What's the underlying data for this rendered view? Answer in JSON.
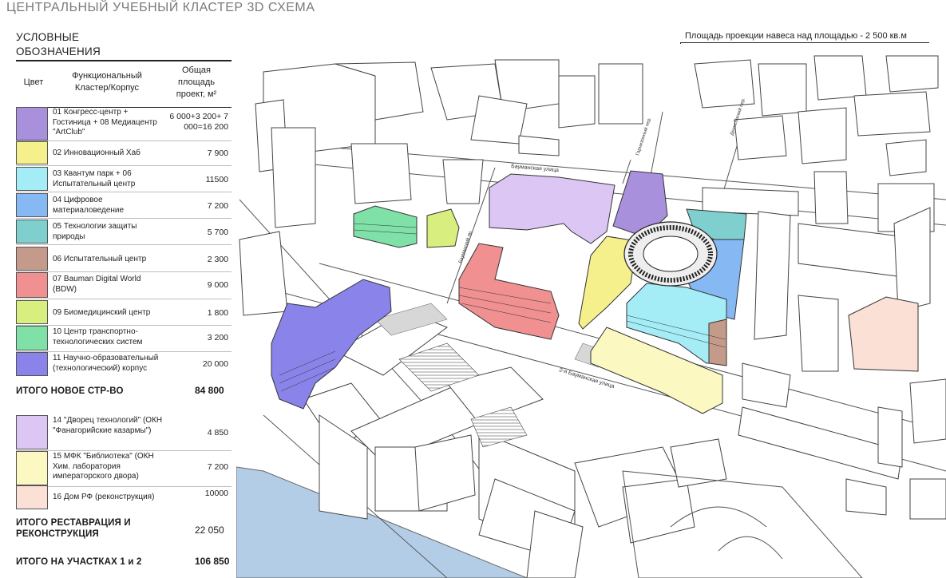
{
  "title": "ЦЕНТРАЛЬНЫЙ УЧЕБНЫЙ КЛАСТЕР 3D СХЕМА",
  "legend": {
    "heading_line1": "УСЛОВНЫЕ",
    "heading_line2": "ОБОЗНАЧЕНИЯ",
    "col_color": "Цвет",
    "col_function": "Функциональный Кластер/Корпус",
    "col_area": "Общая площадь проект, м²",
    "new_items": [
      {
        "name": "01 Конгресс-центр + Гостиница + 08 Медиацентр \"ArtClub\"",
        "area": "6 000+3 200+ 7 000=16 200",
        "color": "#a990dc"
      },
      {
        "name": "02 Инновационный Хаб",
        "area": "7 900",
        "color": "#f6f08c"
      },
      {
        "name": "03 Квантум парк + 06 Испытательный центр",
        "area": "11500",
        "color": "#a4ecf6"
      },
      {
        "name": "04 Цифровое материаловедение",
        "area": "7 200",
        "color": "#86b8f3"
      },
      {
        "name": "05 Технологии защиты природы",
        "area": "5 700",
        "color": "#7fcfcf"
      },
      {
        "name": "06 Испытательный центр",
        "area": "2 300",
        "color": "#c49b8a"
      },
      {
        "name": "07 Bauman Digital World (BDW)",
        "area": "9 000",
        "color": "#f09090"
      },
      {
        "name": "09 Биомедицинский центр",
        "area": "1 800",
        "color": "#d8ef80"
      },
      {
        "name": "10 Центр транспортно-технологических систем",
        "area": "3 200",
        "color": "#7fe0a8"
      },
      {
        "name": "11 Научно-образовательный (технологический) корпус",
        "area": "20 000",
        "color": "#8a84ea"
      }
    ],
    "total_new_label": "ИТОГО НОВОЕ СТР-ВО",
    "total_new_value": "84 800",
    "restore_items": [
      {
        "name": "14 \"Дворец технологий\" (ОКН \"Фанагорийские казармы\")",
        "area": "4 850",
        "color": "#dcc6f4"
      },
      {
        "name": "15 МФК \"Библиотека\" (ОКН Хим. лаборатория императорского двора)",
        "area": "7 200",
        "color": "#fbf8c2"
      },
      {
        "name": "16 Дом РФ (реконструкция)",
        "area": "10000",
        "color": "#fbe0d6"
      }
    ],
    "total_restore_label_line1": "ИТОГО РЕСТАВРАЦИЯ И",
    "total_restore_label_line2": "РЕКОНСТРУКЦИЯ",
    "total_restore_value": "22 050",
    "total_sites_label": "ИТОГО НА УЧАСТКАХ 1 и 2",
    "total_sites_value": "106 850"
  },
  "annotation": "Площадь проекции навеса над площадью - 2 500 кв.м",
  "streets": {
    "baumanskaya": "Бауманская улица",
    "baumanskaya2": "2-я Бауманская улица",
    "lane_left": "Бауманский пр.",
    "lane_mid": "Гарнизонный пер.",
    "lane_right": "Денисовский пер."
  }
}
